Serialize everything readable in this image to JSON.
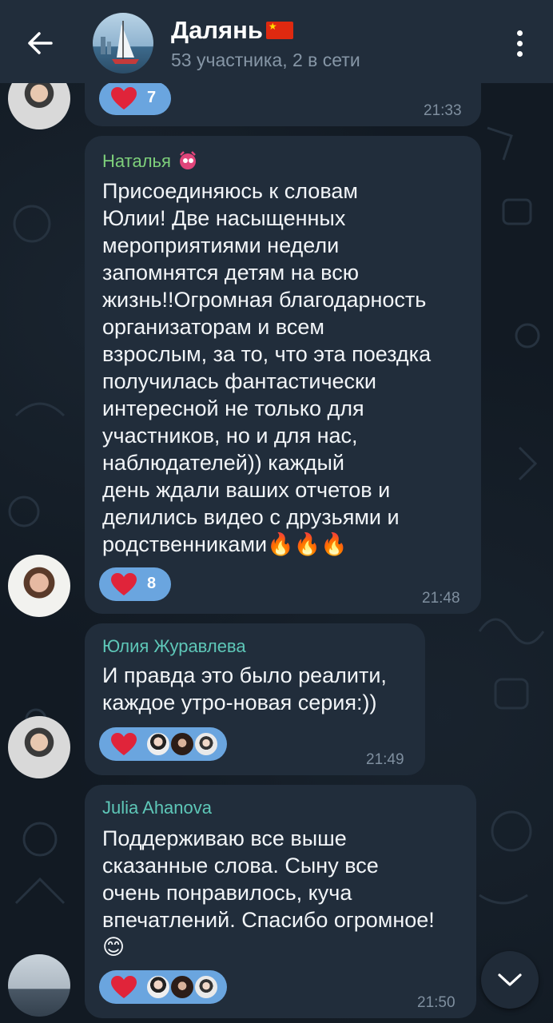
{
  "header": {
    "title": "Далянь",
    "subtitle": "53 участника, 2 в сети"
  },
  "messages": [
    {
      "reaction_count": "7",
      "time": "21:33"
    },
    {
      "sender": "Наталья",
      "sender_color": "#7ed07b",
      "text": "Присоединяюсь к словам\nЮлии! Две насыщенных\nмероприятиями недели\nзапомнятся детям на всю\nжизнь!!Огромная благодарность\nорганизаторам и всем\nвзрослым, за то, что эта поездка\nполучилась фантастически\nинтересной не только для\nучастников, но и для нас,\nнаблюдателей)) каждый\nдень ждали ваших отчетов и\nделились видео с друзьями и\nродственниками🔥🔥🔥",
      "reaction_count": "8",
      "time": "21:48"
    },
    {
      "sender": "Юлия Журавлева",
      "sender_color": "#5ec7b8",
      "text": "И правда это было реалити,\nкаждое утро-новая серия:))",
      "time": "21:49"
    },
    {
      "sender": "Julia Ahanova",
      "sender_color": "#5ec7b8",
      "text": "Поддерживаю все выше\nсказанные слова. Сыну все\nочень понравилось, куча\nвпечатлений. Спасибо огромное!\n😊",
      "time": "21:50"
    }
  ],
  "colors": {
    "header_bg": "#212d3b",
    "bubble_bg": "#212d3b",
    "reaction_bg": "#6aa5df",
    "heart": "#e0243a"
  },
  "icons": {
    "back": "arrow-left-icon",
    "menu": "more-vertical-icon",
    "scroll": "chevron-down-icon",
    "reaction": "heart-icon"
  }
}
